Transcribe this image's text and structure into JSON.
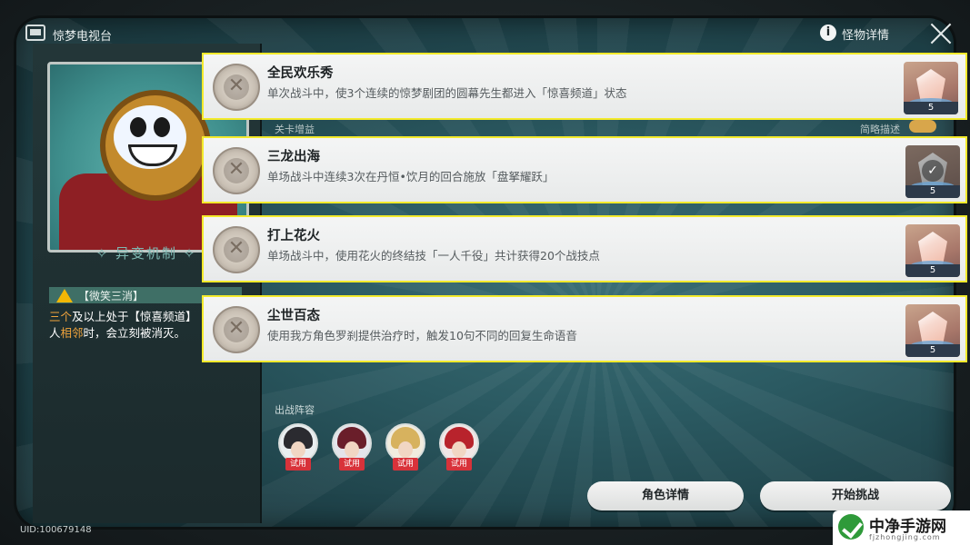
{
  "header": {
    "title": "惊梦电视台",
    "info_label": "怪物详情"
  },
  "left_panel": {
    "mechanic_title": "异变机制",
    "tag": "【微笑三消】",
    "desc_parts": [
      "三个",
      "及以上处于【惊喜频道】",
      "人",
      "相邻",
      "时，会立刻被消灭。"
    ]
  },
  "behind": {
    "left_text": "关卡增益",
    "toggle_label": "简略描述"
  },
  "achievements": [
    {
      "title": "全民欢乐秀",
      "desc": "单次战斗中，使3个连续的惊梦剧团的圆幕先生都进入「惊喜频道」状态",
      "reward_qty": "5",
      "claimed": false
    },
    {
      "title": "三龙出海",
      "desc": "单场战斗中连续3次在丹恒•饮月的回合施放「盘拏耀跃」",
      "reward_qty": "5",
      "claimed": true
    },
    {
      "title": "打上花火",
      "desc": "单场战斗中，使用花火的终结技「一人千役」共计获得20个战技点",
      "reward_qty": "5",
      "claimed": false
    },
    {
      "title": "尘世百态",
      "desc": "使用我方角色罗刹提供治疗时，触发10句不同的回复生命语音",
      "reward_qty": "5",
      "claimed": false
    }
  ],
  "team": {
    "label": "出战阵容",
    "trial_label": "试用",
    "avatars": [
      {
        "hair": "#2b2b30"
      },
      {
        "hair": "#6a1e2a"
      },
      {
        "hair": "#d7b25e"
      },
      {
        "hair": "#b8232c"
      }
    ]
  },
  "buttons": {
    "char_details": "角色详情",
    "start": "开始挑战"
  },
  "uid": "UID:100679148",
  "watermark": {
    "text": "中净手游网",
    "sub": "fjzhongjing.com"
  },
  "colors": {
    "highlight_border": "#f3ea2b",
    "accent_orange": "#f0a33c",
    "trial_red": "#d8323a"
  }
}
